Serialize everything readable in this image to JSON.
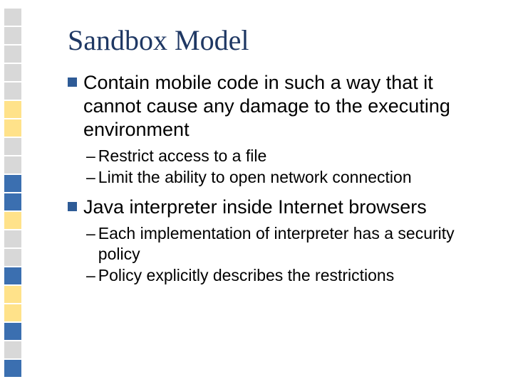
{
  "sidebar_colors": [
    "#d8d8d8",
    "#d8d8d8",
    "#d8d8d8",
    "#d8d8d8",
    "#d8d8d8",
    "#ffe28a",
    "#ffe28a",
    "#d8d8d8",
    "#d8d8d8",
    "#3b6fb0",
    "#3b6fb0",
    "#ffe28a",
    "#d8d8d8",
    "#d8d8d8",
    "#3b6fb0",
    "#ffe28a",
    "#ffe28a",
    "#3b6fb0",
    "#d8d8d8",
    "#3b6fb0"
  ],
  "title": "Sandbox Model",
  "bullets": [
    {
      "text": "Contain mobile code in such a way that it cannot cause any damage to the executing environment",
      "subs": [
        "Restrict access to a file",
        "Limit the ability to open network connection"
      ]
    },
    {
      "text": "Java interpreter inside Internet browsers",
      "subs": [
        "Each implementation of interpreter has a security policy",
        "Policy explicitly describes the restrictions"
      ]
    }
  ],
  "dash": "–"
}
